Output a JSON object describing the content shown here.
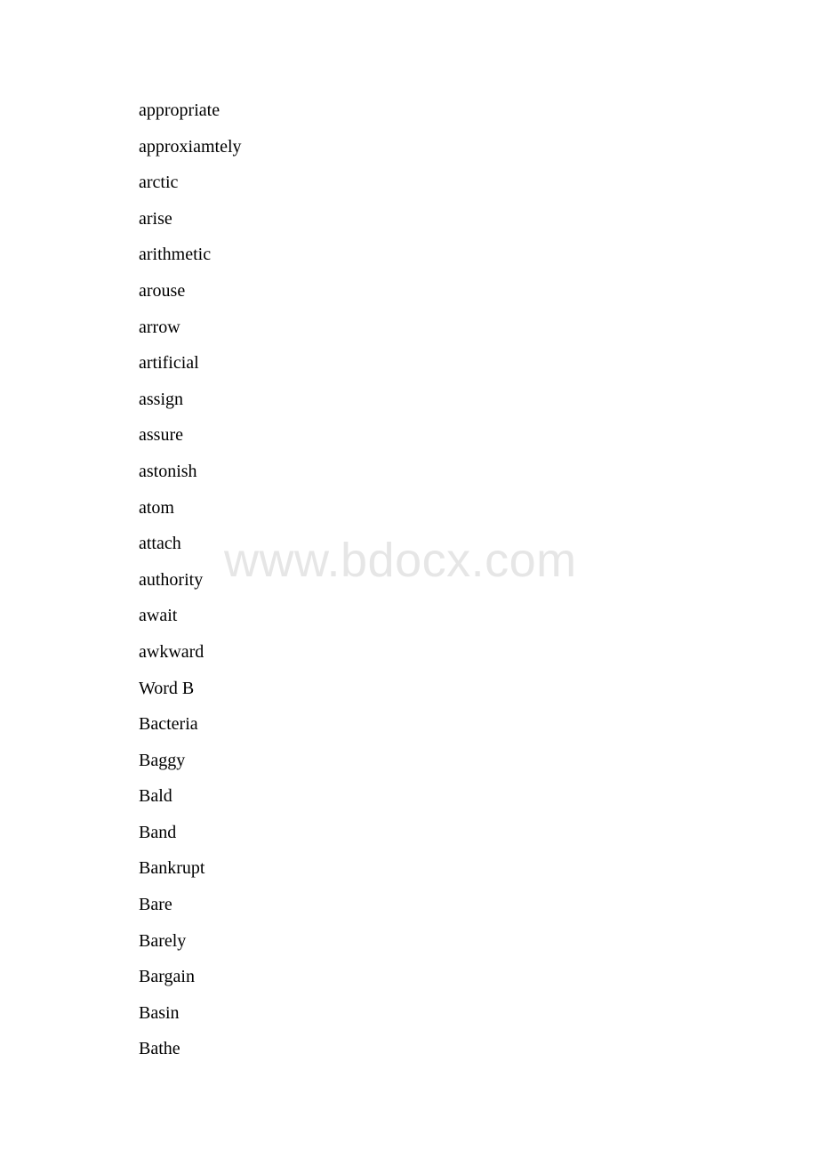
{
  "document": {
    "watermark": "www.bdocx.com",
    "lines": [
      {
        "text": "appropriate",
        "type": "word"
      },
      {
        "text": "approxiamtely",
        "type": "word"
      },
      {
        "text": "arctic",
        "type": "word"
      },
      {
        "text": "arise",
        "type": "word"
      },
      {
        "text": "arithmetic",
        "type": "word"
      },
      {
        "text": "arouse",
        "type": "word"
      },
      {
        "text": "arrow",
        "type": "word"
      },
      {
        "text": "artificial",
        "type": "word"
      },
      {
        "text": "assign",
        "type": "word"
      },
      {
        "text": "assure",
        "type": "word"
      },
      {
        "text": "astonish",
        "type": "word"
      },
      {
        "text": "atom",
        "type": "word"
      },
      {
        "text": "attach",
        "type": "word"
      },
      {
        "text": "authority",
        "type": "word"
      },
      {
        "text": "await",
        "type": "word"
      },
      {
        "text": "awkward",
        "type": "word"
      },
      {
        "text": "Word B",
        "type": "heading"
      },
      {
        "text": "Bacteria",
        "type": "word"
      },
      {
        "text": "Baggy",
        "type": "word"
      },
      {
        "text": "Bald",
        "type": "word"
      },
      {
        "text": "Band",
        "type": "word"
      },
      {
        "text": "Bankrupt",
        "type": "word"
      },
      {
        "text": "Bare",
        "type": "word"
      },
      {
        "text": "Barely",
        "type": "word"
      },
      {
        "text": "Bargain",
        "type": "word"
      },
      {
        "text": "Basin",
        "type": "word"
      },
      {
        "text": "Bathe",
        "type": "word"
      }
    ]
  }
}
